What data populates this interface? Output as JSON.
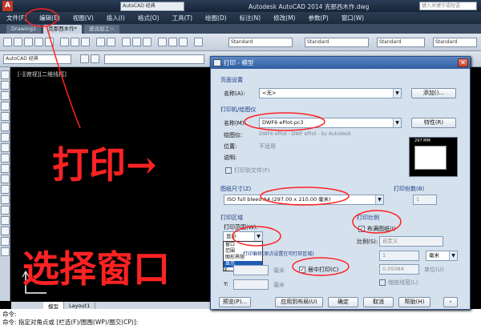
{
  "titlebar": {
    "app_combo": "AutoCAD 经典",
    "title": "Autodesk AutoCAD 2014  克那西木作.dwg",
    "search_placeholder": "键入关键字或短语"
  },
  "menubar": {
    "items": [
      "文件(F)",
      "编辑(E)",
      "视图(V)",
      "插入(I)",
      "格式(O)",
      "工具(T)",
      "绘图(D)",
      "标注(N)",
      "修改(M)",
      "参数(P)",
      "窗口(W)"
    ]
  },
  "doc_tabs": [
    "Drawing1",
    "克那西木作*",
    "波派加工☆"
  ],
  "toolbar": {
    "workspace": "AutoCAD 经典",
    "style1": "Standard",
    "style2": "Standard",
    "style3": "Standard",
    "style4": "Standard"
  },
  "viewport": {
    "label": "[-][俯视][二维线框]"
  },
  "layout_tabs": [
    "模型",
    "Layout1"
  ],
  "command_lines": [
    "命令:",
    "命令: 指定对角点或 [栏选(F)/圈围(WP)/圈交(CP)]:"
  ],
  "dialog": {
    "title": "打印 - 模型",
    "page_setup": {
      "group": "页面设置",
      "name_label": "名称(A):",
      "name_value": "<无>",
      "add_button": "添加()..."
    },
    "printer": {
      "group": "打印机/绘图仪",
      "name_label": "名称(M):",
      "name_value": "DWF6 ePlot.pc3",
      "properties_button": "特性(R)",
      "plotter_label": "绘图仪:",
      "plotter_value": "DWF6 ePlot - DWF ePlot - by Autodesk",
      "location_label": "位置:",
      "location_value": "不适用",
      "description_label": "说明:",
      "print_to_file": "打印到文件(F)",
      "preview_dim": "297 MM"
    },
    "paper": {
      "group": "图纸尺寸(Z)",
      "value": "ISO full bleed A4 (297.00 x 210.00 毫米)"
    },
    "copies": {
      "group": "打印份数(B)",
      "value": "1"
    },
    "area": {
      "group": "打印区域",
      "range_label": "打印范围(W):",
      "range_value": "显示",
      "options": [
        "窗口",
        "范围",
        "图形界限",
        "显示"
      ],
      "offset_group": "打印偏移(原点设置在可打印区域)",
      "x_label": "X:",
      "y_label": "Y:",
      "unit": "毫米",
      "center_print": "居中打印(C)"
    },
    "scale": {
      "group": "打印比例",
      "fit": "布满图纸(I)",
      "scale_label": "比例(S):",
      "scale_value": "自定义",
      "value1": "1",
      "unit": "毫米",
      "value2": "0.05084",
      "unit2": "单位(U)",
      "linewidth": "缩放线宽(L)"
    },
    "buttons": {
      "preview": "预览(P)...",
      "apply": "应用到布局(U)",
      "ok": "确定",
      "cancel": "取消",
      "help": "帮助(H)"
    }
  },
  "annotations": {
    "print": "打印→",
    "select_window": "选择窗口"
  },
  "colors": {
    "annotation": "#ff2222",
    "dialog_bg": "#d6e1ee",
    "title_blue": "#2f5da0"
  }
}
